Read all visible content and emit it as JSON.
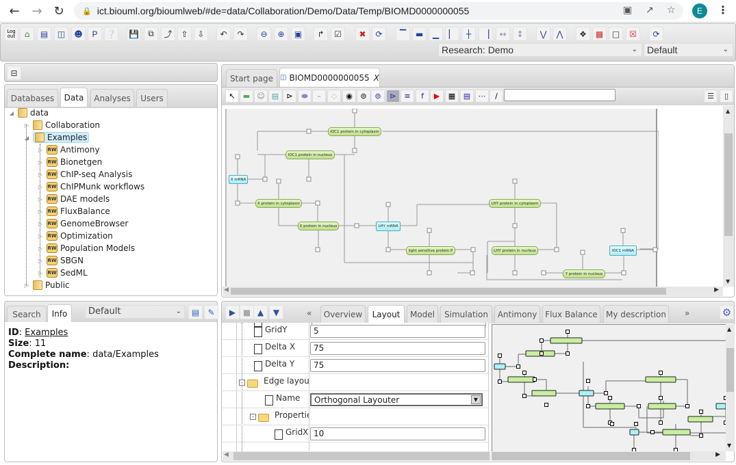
{
  "browser": {
    "url": "ict.biouml.org/bioumlweb/#de=data/Collaboration/Demo/Data/Temp/BIOMD0000000055",
    "avatar_letter": "E",
    "icons": [
      "back-icon",
      "forward-icon",
      "reload-icon",
      "lock-icon",
      "translate-icon",
      "share-icon",
      "star-icon",
      "menu-icon"
    ]
  },
  "toolbar": {
    "logout_label": "Log out",
    "research_select": "Research: Demo",
    "perspective_select": "Default"
  },
  "left_tabs": [
    {
      "label": "Databases",
      "active": false
    },
    {
      "label": "Data",
      "active": true
    },
    {
      "label": "Analyses",
      "active": false
    },
    {
      "label": "Users",
      "active": false
    }
  ],
  "tree": {
    "root": "data",
    "level1": [
      "Collaboration",
      "Examples",
      "Public"
    ],
    "selected": "Examples",
    "examples_children": [
      "Antimony",
      "Bionetgen",
      "ChIP-seq Analysis",
      "ChIPMunk workflows",
      "DAE models",
      "FluxBalance",
      "GenomeBrowser",
      "Optimization",
      "Population Models",
      "SBGN",
      "SedML"
    ]
  },
  "info_panel": {
    "tabs": [
      {
        "label": "Search",
        "active": false
      },
      {
        "label": "Info",
        "active": true
      }
    ],
    "view_select": "Default",
    "id_label": "ID",
    "id_value": "Examples",
    "size_label": "Size",
    "size_value": "11",
    "complete_name_label": "Complete name",
    "complete_name_value": "data/Examples",
    "description_label": "Description:"
  },
  "editor": {
    "tabs": [
      {
        "label": "Start page",
        "active": false
      },
      {
        "label": "BIOMD0000000055",
        "active": true,
        "closable": true
      }
    ],
    "close_glyph": "X",
    "search_value": ""
  },
  "diagram": {
    "nodes": [
      {
        "label": "IOC1 protein in cytoplasm",
        "type": "protein"
      },
      {
        "label": "IOC1 protein in nucleus",
        "type": "protein"
      },
      {
        "label": "X mRNA",
        "type": "mrna"
      },
      {
        "label": "X protein in cytoplasm",
        "type": "protein"
      },
      {
        "label": "X protein in nucleus",
        "type": "protein"
      },
      {
        "label": "LHY mRNA",
        "type": "mrna"
      },
      {
        "label": "LHY protein in cytoplasm",
        "type": "protein"
      },
      {
        "label": "light sensitive protein P",
        "type": "protein"
      },
      {
        "label": "LHY protein in nucleus",
        "type": "protein"
      },
      {
        "label": "IOC1 mRNA",
        "type": "mrna"
      },
      {
        "label": "Y protein in nucleus",
        "type": "protein"
      }
    ]
  },
  "bottom_panel": {
    "tabs": [
      {
        "label": "Overview",
        "active": false
      },
      {
        "label": "Layout",
        "active": true
      },
      {
        "label": "Model",
        "active": false
      },
      {
        "label": "Simulation",
        "active": false
      },
      {
        "label": "Antimony",
        "active": false
      },
      {
        "label": "Flux Balance",
        "active": false
      },
      {
        "label": "My description",
        "active": false
      }
    ],
    "prev_glyph": "«",
    "next_glyph": "»",
    "properties": [
      {
        "name": "GridY",
        "value": "5"
      },
      {
        "name": "Delta X",
        "value": "75"
      },
      {
        "name": "Delta Y",
        "value": "75"
      },
      {
        "name": "Edge layout",
        "value": ""
      },
      {
        "name": "Name",
        "value": "Orthogonal Layouter"
      },
      {
        "name": "Properties",
        "value": ""
      },
      {
        "name": "GridX",
        "value": "10"
      }
    ]
  }
}
